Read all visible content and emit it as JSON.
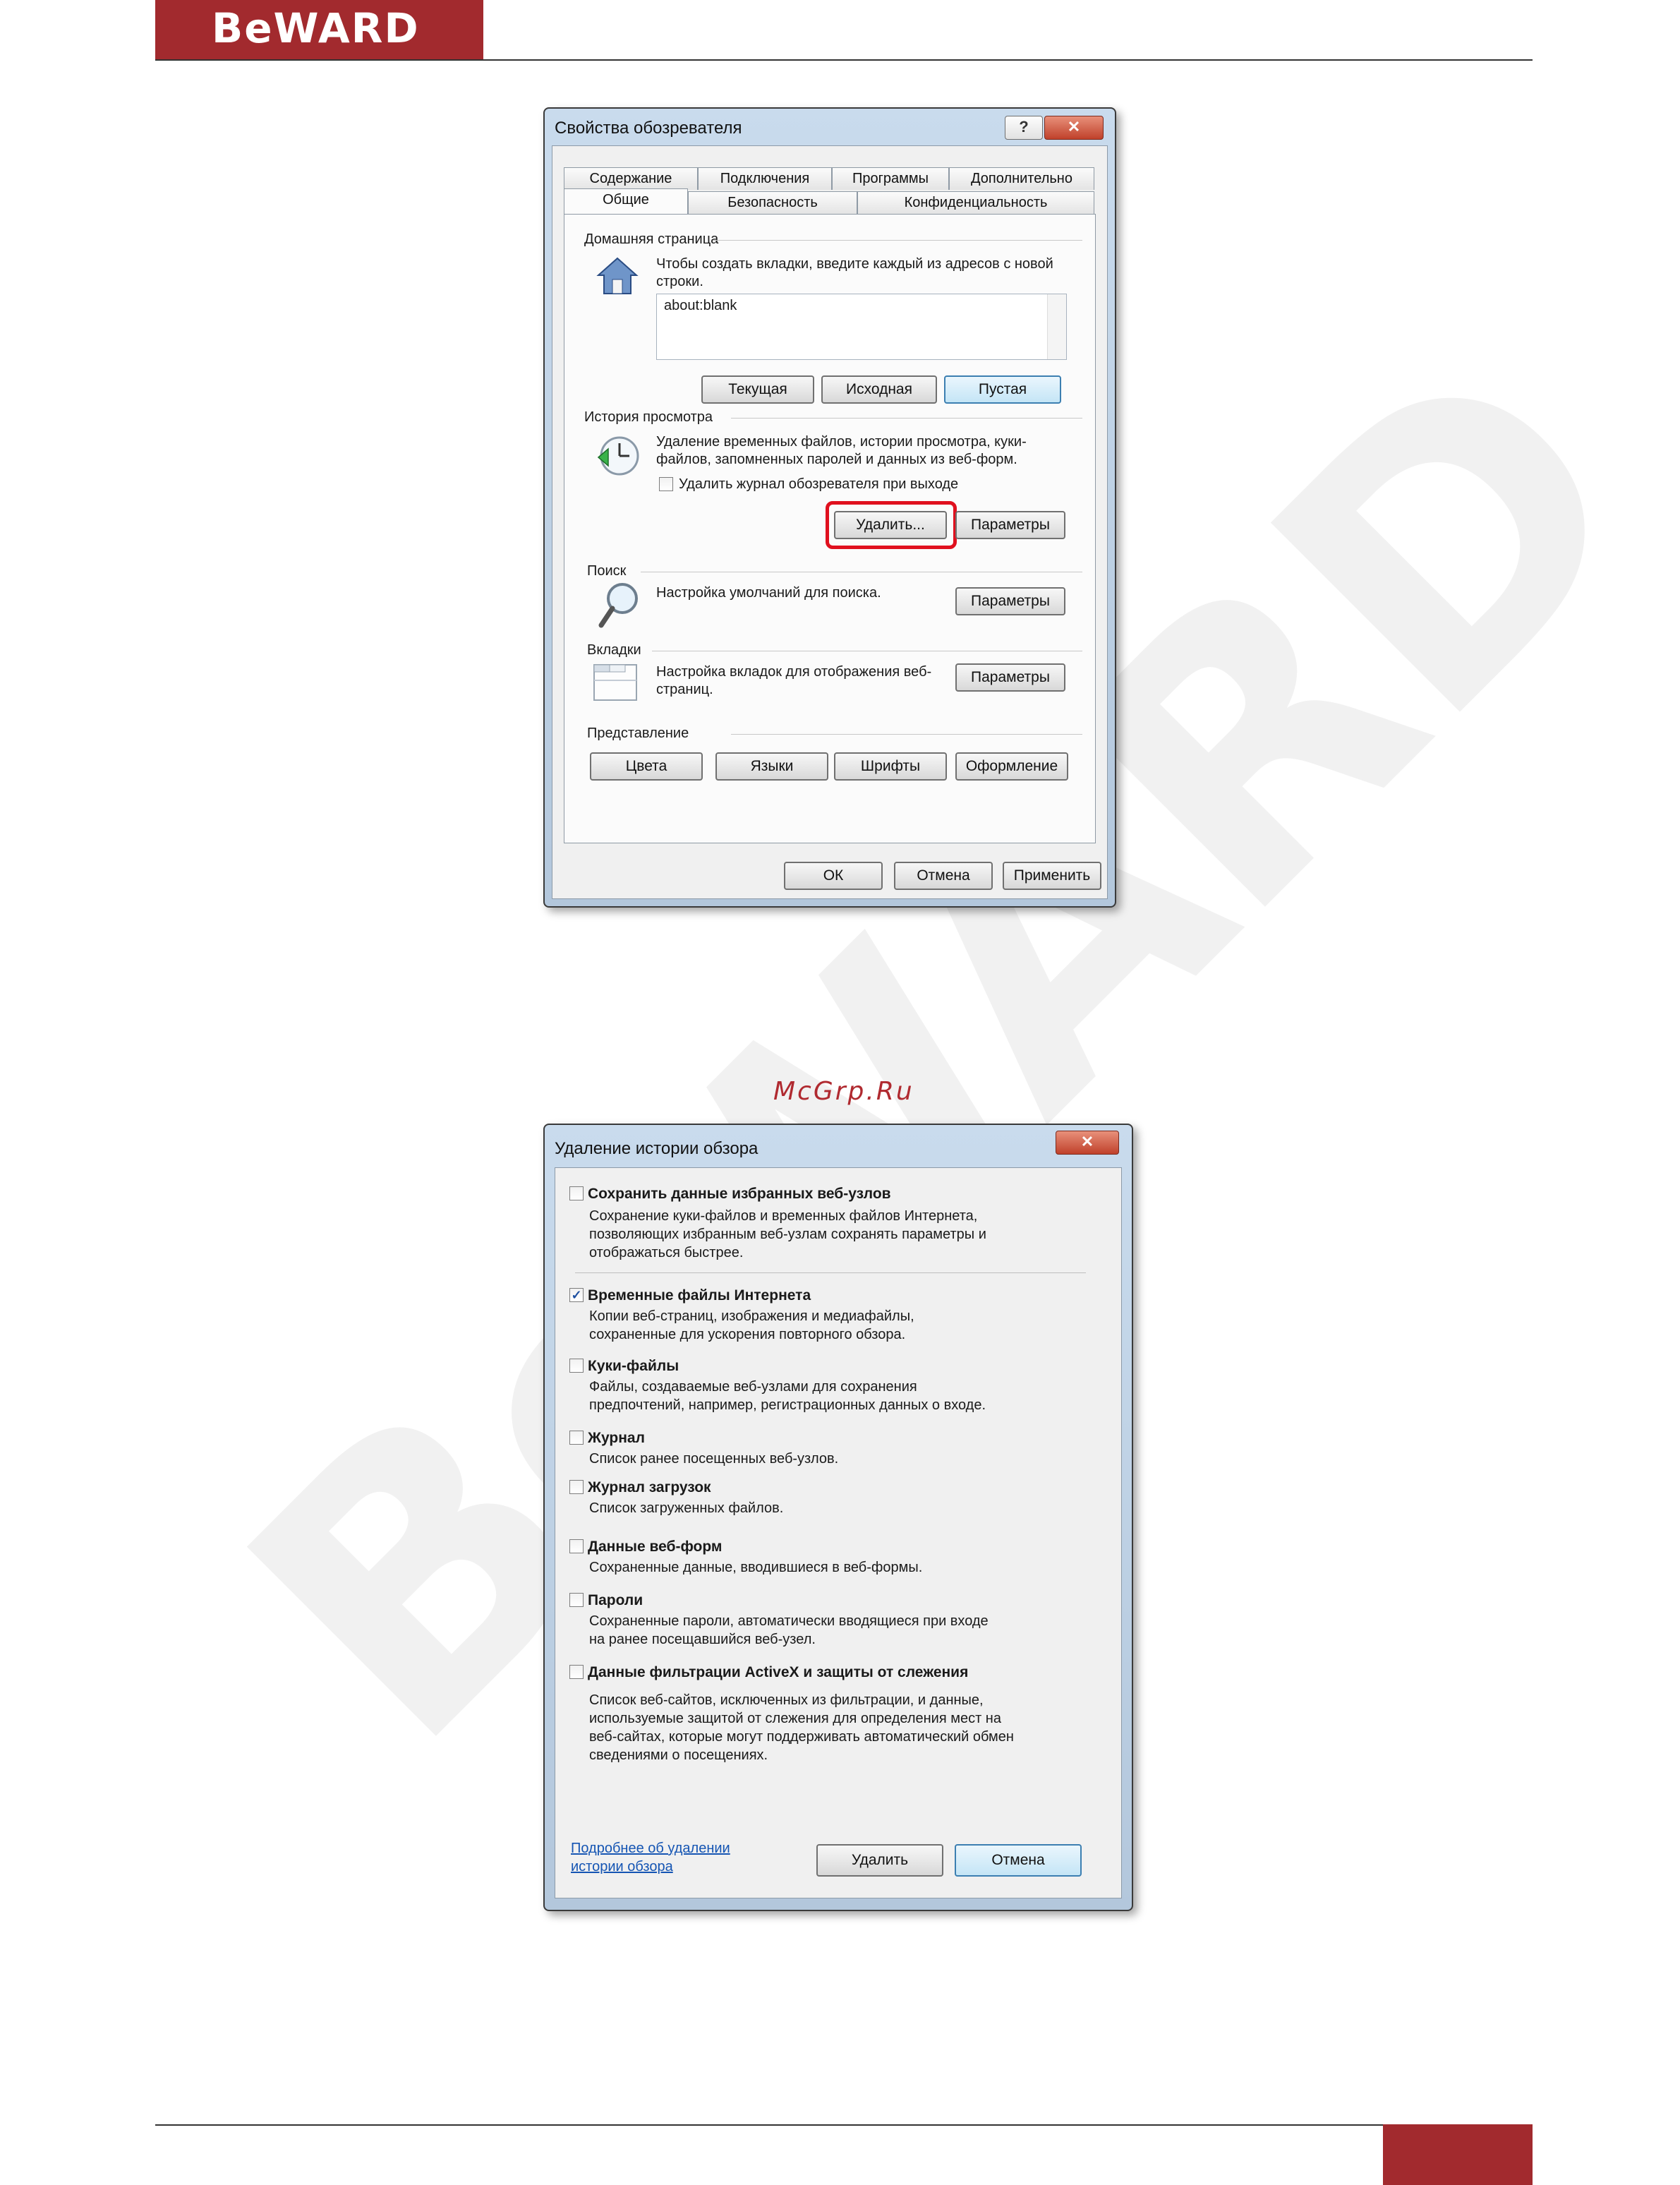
{
  "page": {
    "brand": "BeWARD",
    "watermark": "BeWARD",
    "site_label": "McGrp.Ru"
  },
  "colors": {
    "brand": "#a22a2e",
    "highlight": "#e0101e",
    "link": "#1555b3"
  },
  "internet_options": {
    "title": "Свойства обозревателя",
    "title_buttons": [
      "?",
      "✕"
    ],
    "tabs_row1": [
      "Содержание",
      "Подключения",
      "Программы",
      "Дополнительно"
    ],
    "tabs_row2": [
      "Общие",
      "Безопасность",
      "Конфиденциальность"
    ],
    "active_tab": "Общие",
    "home": {
      "group": "Домашняя страница",
      "hint": "Чтобы создать вкладки, введите каждый из адресов с новой строки.",
      "value": "about:blank",
      "buttons": [
        "Текущая",
        "Исходная",
        "Пустая"
      ]
    },
    "history": {
      "group": "История просмотра",
      "desc": "Удаление временных файлов, истории просмотра, куки-файлов, запомненных паролей и данных из веб-форм.",
      "checkbox": "Удалить журнал обозревателя при выходе",
      "delete_button": "Удалить...",
      "settings_button": "Параметры"
    },
    "search": {
      "group": "Поиск",
      "desc": "Настройка умолчаний для поиска.",
      "button": "Параметры"
    },
    "tabs_group": {
      "group": "Вкладки",
      "desc": "Настройка вкладок для отображения веб-страниц.",
      "button": "Параметры"
    },
    "appearance": {
      "group": "Представление",
      "buttons": [
        "Цвета",
        "Языки",
        "Шрифты",
        "Оформление"
      ]
    },
    "footer": {
      "ok": "ОК",
      "cancel": "Отмена",
      "apply": "Применить"
    }
  },
  "delete_history": {
    "title": "Удаление истории обзора",
    "close": "✕",
    "items": [
      {
        "label": "Сохранить данные избранных веб-узлов",
        "desc": [
          "Сохранение куки-файлов и временных файлов Интернета,",
          "позволяющих избранным веб-узлам сохранять параметры и",
          "отображаться быстрее."
        ],
        "checked": false
      },
      {
        "label": "Временные файлы Интернета",
        "desc": [
          "Копии веб-страниц, изображения и медиафайлы,",
          "сохраненные для ускорения повторного обзора."
        ],
        "checked": true
      },
      {
        "label": "Куки-файлы",
        "desc": [
          "Файлы, создаваемые веб-узлами для сохранения",
          "предпочтений, например, регистрационных данных о входе."
        ],
        "checked": false
      },
      {
        "label": "Журнал",
        "desc": [
          "Список ранее посещенных веб-узлов."
        ],
        "checked": false
      },
      {
        "label": "Журнал загрузок",
        "desc": [
          "Список загруженных файлов."
        ],
        "checked": false
      },
      {
        "label": "Данные веб-форм",
        "desc": [
          "Сохраненные данные, вводившиеся в веб-формы."
        ],
        "checked": false
      },
      {
        "label": "Пароли",
        "desc": [
          "Сохраненные пароли, автоматически вводящиеся при входе",
          "на ранее посещавшийся веб-узел."
        ],
        "checked": false
      },
      {
        "label": "Данные фильтрации ActiveX и защиты от слежения",
        "desc": [
          "Список веб-сайтов, исключенных из фильтрации, и данные,",
          "используемые защитой от слежения для определения мест на",
          "веб-сайтах, которые могут поддерживать автоматический обмен",
          "сведениями о посещениях."
        ],
        "checked": false
      }
    ],
    "link": [
      "Подробнее об удалении",
      "истории обзора"
    ],
    "delete_button": "Удалить",
    "cancel_button": "Отмена"
  }
}
